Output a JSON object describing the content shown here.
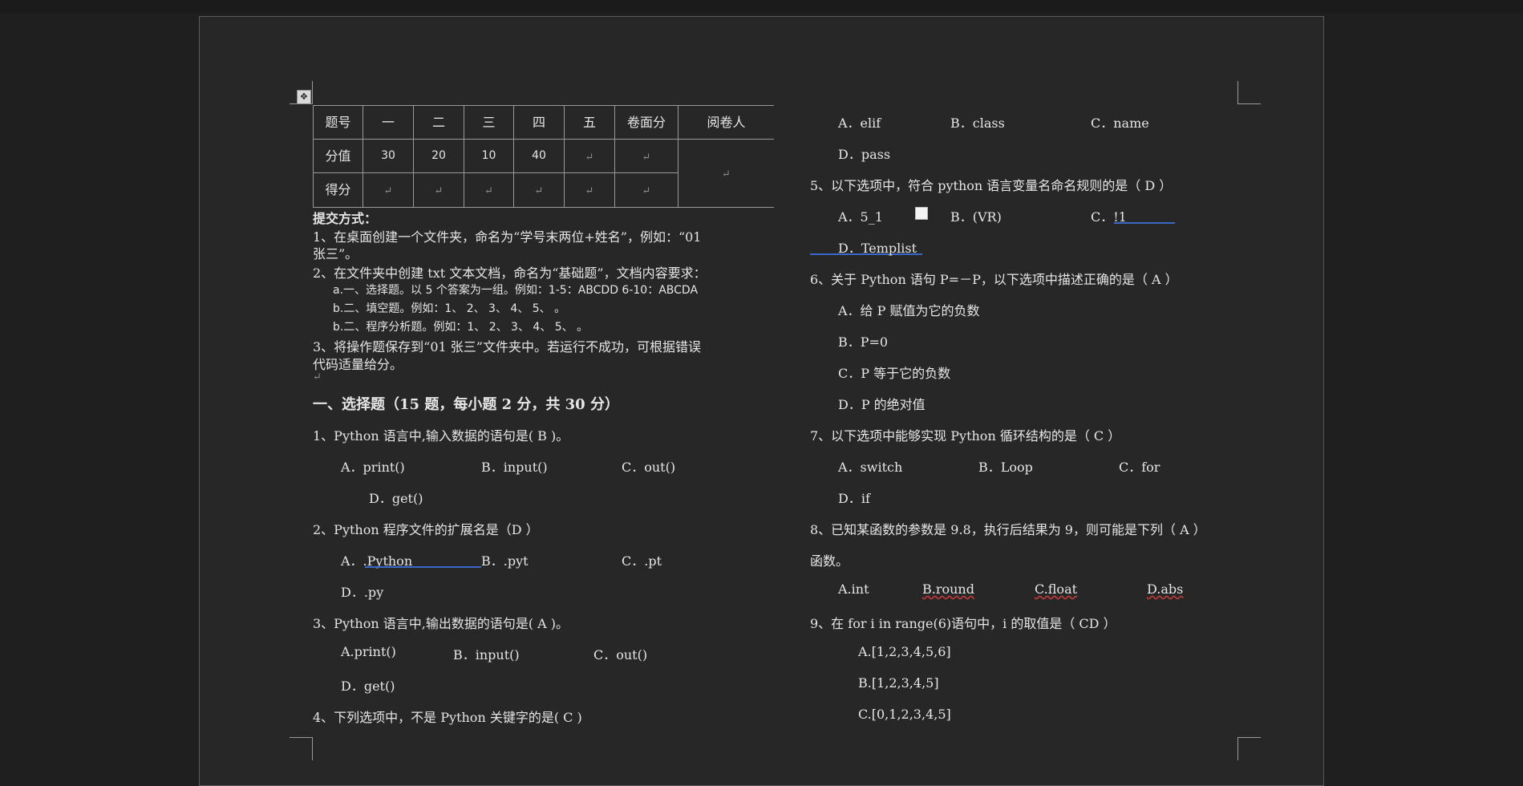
{
  "table": {
    "header": [
      "题号",
      "一",
      "二",
      "三",
      "四",
      "五",
      "卷面分",
      "阅卷人"
    ],
    "score_row": [
      "分值",
      "30",
      "20",
      "10",
      "40",
      "",
      "",
      ""
    ],
    "got_row": [
      "得分",
      "",
      "",
      "",
      "",
      "",
      ""
    ]
  },
  "submission": {
    "title": "提交方式：",
    "line1a": "1、在桌面创建一个文件夹，命名为“学号末两位+姓名”，例如：“01",
    "line1b": "张三”。",
    "line2": "2、在文件夹中创建 txt 文本文档，命名为“基础题”，文档内容要求：",
    "sub_a": "a.一、选择题。以 5 个答案为一组。例如：1-5：ABCDD   6-10：ABCDA",
    "sub_b1": "b.二、填空题。例如：1、   2、      3、        4、        5、         。",
    "sub_b2": "b.二、程序分析题。例如：1、   2、      3、        4、        5、         。",
    "line3a": "3、将操作题保存到“01 张三”文件夹中。若运行不成功，可根据错误",
    "line3b": "代码适量给分。"
  },
  "section1_title": "一、选择题（15 题，每小题 2 分，共 30 分）",
  "q1": {
    "stem": "1、Python 语言中,输入数据的语句是(   B )。",
    "a": "A．print()",
    "b": "B．input()",
    "c": "C．out()",
    "d": "D．get()"
  },
  "q2": {
    "stem": "2、Python 程序文件的扩展名是（D ）",
    "a": "A．.Python",
    "b": "B．.pyt",
    "c": "C．.pt",
    "d": "D．.py"
  },
  "q3": {
    "stem": "3、Python 语言中,输出数据的语句是(   A   )。",
    "a": "A.print()",
    "b": "B．input()",
    "c": "C．out()",
    "d": "D．get()"
  },
  "q4": {
    "stem": "4、下列选项中，不是 Python 关键字的是( C   )",
    "a": "A．elif",
    "b": "B．class",
    "c": "C．name",
    "d": "D．pass"
  },
  "q5": {
    "stem": "5、以下选项中，符合 python 语言变量名命名规则的是（  D ）",
    "a": "A．5_1",
    "b": "B．(VR)",
    "c": "C．!1",
    "d": "D．Templist"
  },
  "q6": {
    "stem": "6、关于 Python 语句 P=－P，以下选项中描述正确的是（  A ）",
    "a": "A．给 P 赋值为它的负数",
    "b": "B．P=0",
    "c": "C．P 等于它的负数",
    "d": "D．P 的绝对值"
  },
  "q7": {
    "stem": "7、以下选项中能够实现 Python 循环结构的是（  C  ）",
    "a": "A．switch",
    "b": "B．Loop",
    "c": "C．for",
    "d": "D．if"
  },
  "q8": {
    "stem_a": "8、已知某函数的参数是 9.8，执行后结果为 9，则可能是下列（  A ）",
    "stem_b": "函数。",
    "a": "A.int",
    "b": "B.round",
    "c": "C.float",
    "d": "D.abs"
  },
  "q9": {
    "stem": "9、在 for i in range(6)语句中，i 的取值是（    CD  ）",
    "a": "A.[1,2,3,4,5,6]",
    "b": "B.[1,2,3,4,5]",
    "c": "C.[0,1,2,3,4,5]"
  },
  "marks": {
    "para": "↵",
    "move": "✥"
  }
}
